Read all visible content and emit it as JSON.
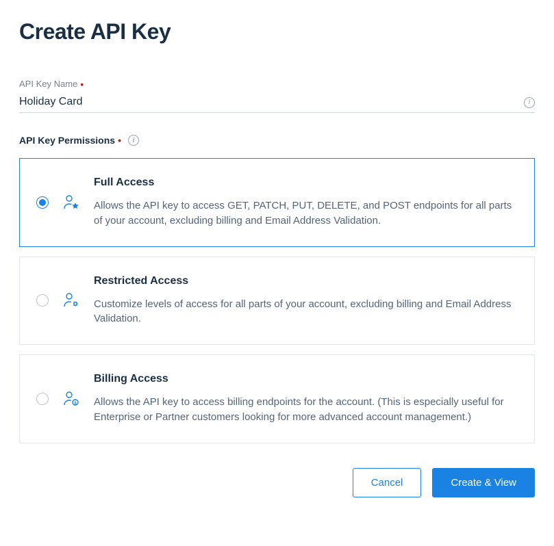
{
  "page": {
    "title": "Create API Key"
  },
  "form": {
    "name_label": "API Key Name",
    "name_value": "Holiday Card",
    "permissions_label": "API Key Permissions",
    "options": [
      {
        "title": "Full Access",
        "description": "Allows the API key to access GET, PATCH, PUT, DELETE, and POST endpoints for all parts of your account, excluding billing and Email Address Validation.",
        "selected": true
      },
      {
        "title": "Restricted Access",
        "description": "Customize levels of access for all parts of your account, excluding billing and Email Address Validation.",
        "selected": false
      },
      {
        "title": "Billing Access",
        "description": "Allows the API key to access billing endpoints for the account. (This is especially useful for Enterprise or Partner customers looking for more advanced account management.)",
        "selected": false
      }
    ]
  },
  "actions": {
    "cancel": "Cancel",
    "submit": "Create & View"
  }
}
